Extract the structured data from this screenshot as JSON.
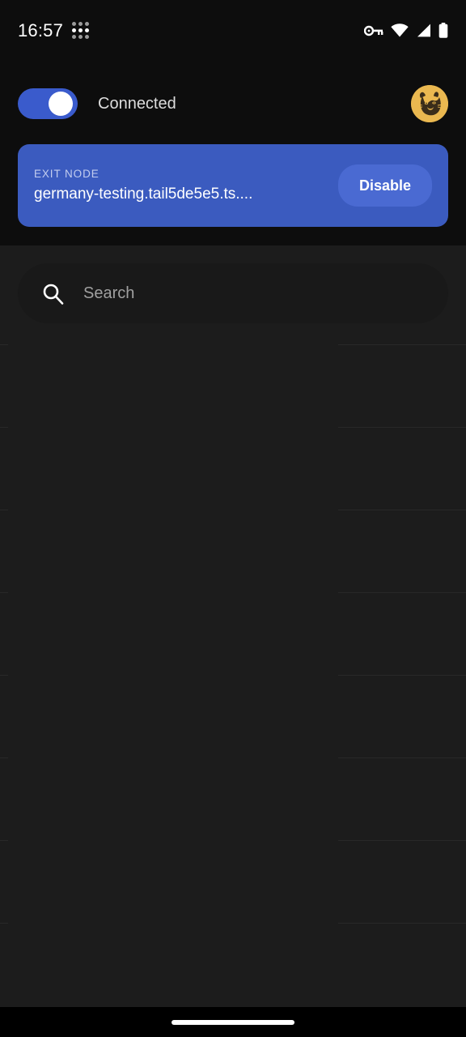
{
  "status_bar": {
    "time": "16:57",
    "notification_dots_icon": "dot-grid-icon",
    "icons": [
      {
        "name": "vpn-key-icon",
        "label": "VPN key"
      },
      {
        "name": "wifi-icon",
        "label": "Wi-Fi full signal"
      },
      {
        "name": "cellular-signal-icon",
        "label": "Cellular signal"
      },
      {
        "name": "battery-icon",
        "label": "Battery"
      }
    ]
  },
  "header": {
    "vpn_toggle": {
      "state": "on",
      "name": "vpn-connection-toggle"
    },
    "connection_status": "Connected",
    "avatar": {
      "name": "user-avatar",
      "image": "tiger-head-avatar",
      "background_color": "#eab850"
    }
  },
  "exit_node": {
    "kicker": "EXIT NODE",
    "hostname": "germany-testing.tail5de5e5.ts....",
    "action_label": "Disable",
    "card_color": "#3b5bbf",
    "button_color": "#4a6ad2"
  },
  "search": {
    "placeholder": "Search",
    "value": "",
    "icon": "search-icon"
  },
  "device_list": {
    "items": [],
    "empty": true,
    "placeholder_row_count": 8
  },
  "navigation_bar": {
    "gesture_pill": "home-gesture-pill"
  },
  "colors": {
    "accent_blue": "#3a5bcc",
    "header_background": "#0d0d0d",
    "content_background": "#1c1c1c",
    "search_background": "#191919",
    "nav_background": "#000000"
  }
}
